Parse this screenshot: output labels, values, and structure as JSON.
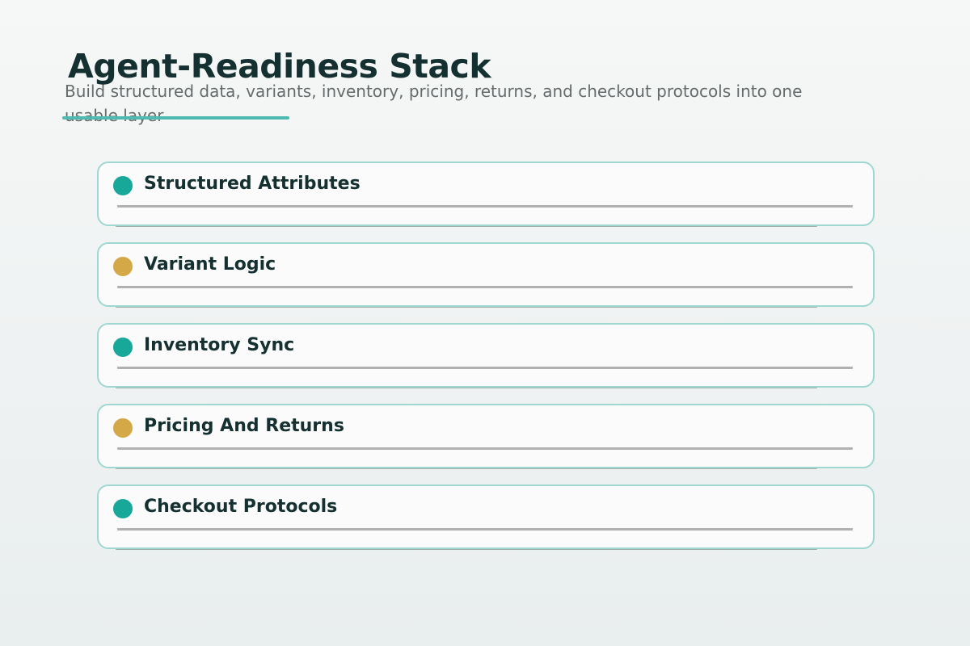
{
  "header": {
    "title": "Agent-Readiness Stack",
    "subtitle": "Build structured data, variants, inventory, pricing, returns, and checkout protocols into one usable layer"
  },
  "colors": {
    "accent_teal": "#17a89a",
    "accent_gold": "#d4a847",
    "title_rule": "#4fbab2",
    "card_border": "#9ed8d0"
  },
  "stack": [
    {
      "label": "Structured Attributes",
      "dot_color": "#17a89a"
    },
    {
      "label": "Variant Logic",
      "dot_color": "#d4a847"
    },
    {
      "label": "Inventory Sync",
      "dot_color": "#17a89a"
    },
    {
      "label": "Pricing And Returns",
      "dot_color": "#d4a847"
    },
    {
      "label": "Checkout Protocols",
      "dot_color": "#17a89a"
    }
  ]
}
